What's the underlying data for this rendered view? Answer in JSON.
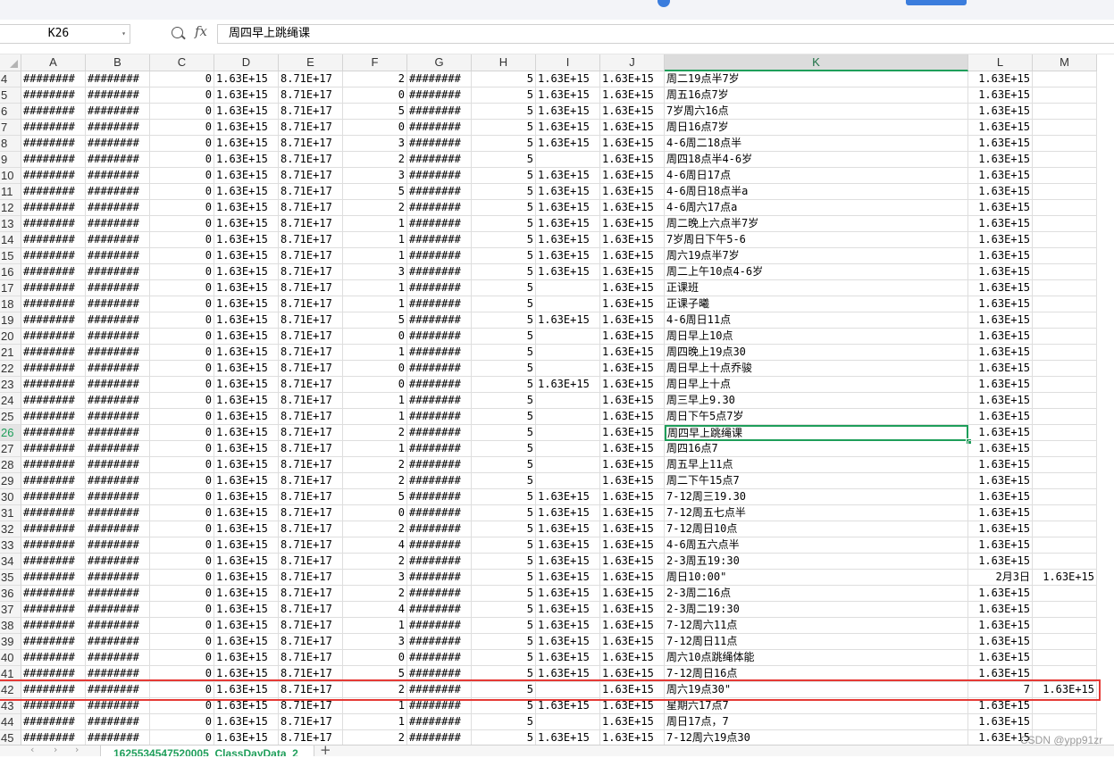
{
  "name_box": "K26",
  "fx_label": "fx",
  "formula_bar": "周四早上跳绳课",
  "active_cell": "K26",
  "columns": [
    "A",
    "B",
    "C",
    "D",
    "E",
    "F",
    "G",
    "H",
    "I",
    "J",
    "K",
    "L",
    "M"
  ],
  "selected_column": "K",
  "rows": [
    {
      "n": "4",
      "A": "########",
      "B": "########",
      "C": "0",
      "D": "1.63E+15",
      "E": "8.71E+17",
      "F": "2",
      "G": "########",
      "H": "5",
      "I": "1.63E+15",
      "J": "1.63E+15",
      "K": "周二19点半7岁",
      "L": "1.63E+15",
      "M": ""
    },
    {
      "n": "5",
      "A": "########",
      "B": "########",
      "C": "0",
      "D": "1.63E+15",
      "E": "8.71E+17",
      "F": "0",
      "G": "########",
      "H": "5",
      "I": "1.63E+15",
      "J": "1.63E+15",
      "K": "周五16点7岁",
      "L": "1.63E+15",
      "M": ""
    },
    {
      "n": "6",
      "A": "########",
      "B": "########",
      "C": "0",
      "D": "1.63E+15",
      "E": "8.71E+17",
      "F": "5",
      "G": "########",
      "H": "5",
      "I": "1.63E+15",
      "J": "1.63E+15",
      "K": "7岁周六16点",
      "L": "1.63E+15",
      "M": ""
    },
    {
      "n": "7",
      "A": "########",
      "B": "########",
      "C": "0",
      "D": "1.63E+15",
      "E": "8.71E+17",
      "F": "0",
      "G": "########",
      "H": "5",
      "I": "1.63E+15",
      "J": "1.63E+15",
      "K": "周日16点7岁",
      "L": "1.63E+15",
      "M": ""
    },
    {
      "n": "8",
      "A": "########",
      "B": "########",
      "C": "0",
      "D": "1.63E+15",
      "E": "8.71E+17",
      "F": "3",
      "G": "########",
      "H": "5",
      "I": "1.63E+15",
      "J": "1.63E+15",
      "K": "4-6周二18点半",
      "L": "1.63E+15",
      "M": ""
    },
    {
      "n": "9",
      "A": "########",
      "B": "########",
      "C": "0",
      "D": "1.63E+15",
      "E": "8.71E+17",
      "F": "2",
      "G": "########",
      "H": "5",
      "I": "",
      "J": "1.63E+15",
      "K": "周四18点半4-6岁",
      "L": "1.63E+15",
      "M": ""
    },
    {
      "n": "10",
      "A": "########",
      "B": "########",
      "C": "0",
      "D": "1.63E+15",
      "E": "8.71E+17",
      "F": "3",
      "G": "########",
      "H": "5",
      "I": "1.63E+15",
      "J": "1.63E+15",
      "K": "4-6周日17点",
      "L": "1.63E+15",
      "M": ""
    },
    {
      "n": "11",
      "A": "########",
      "B": "########",
      "C": "0",
      "D": "1.63E+15",
      "E": "8.71E+17",
      "F": "5",
      "G": "########",
      "H": "5",
      "I": "1.63E+15",
      "J": "1.63E+15",
      "K": "4-6周日18点半a",
      "L": "1.63E+15",
      "M": ""
    },
    {
      "n": "12",
      "A": "########",
      "B": "########",
      "C": "0",
      "D": "1.63E+15",
      "E": "8.71E+17",
      "F": "2",
      "G": "########",
      "H": "5",
      "I": "1.63E+15",
      "J": "1.63E+15",
      "K": "4-6周六17点a",
      "L": "1.63E+15",
      "M": ""
    },
    {
      "n": "13",
      "A": "########",
      "B": "########",
      "C": "0",
      "D": "1.63E+15",
      "E": "8.71E+17",
      "F": "1",
      "G": "########",
      "H": "5",
      "I": "1.63E+15",
      "J": "1.63E+15",
      "K": "周二晚上六点半7岁",
      "L": "1.63E+15",
      "M": ""
    },
    {
      "n": "14",
      "A": "########",
      "B": "########",
      "C": "0",
      "D": "1.63E+15",
      "E": "8.71E+17",
      "F": "1",
      "G": "########",
      "H": "5",
      "I": "1.63E+15",
      "J": "1.63E+15",
      "K": "7岁周日下午5-6",
      "L": "1.63E+15",
      "M": ""
    },
    {
      "n": "15",
      "A": "########",
      "B": "########",
      "C": "0",
      "D": "1.63E+15",
      "E": "8.71E+17",
      "F": "1",
      "G": "########",
      "H": "5",
      "I": "1.63E+15",
      "J": "1.63E+15",
      "K": "周六19点半7岁",
      "L": "1.63E+15",
      "M": ""
    },
    {
      "n": "16",
      "A": "########",
      "B": "########",
      "C": "0",
      "D": "1.63E+15",
      "E": "8.71E+17",
      "F": "3",
      "G": "########",
      "H": "5",
      "I": "1.63E+15",
      "J": "1.63E+15",
      "K": "周二上午10点4-6岁",
      "L": "1.63E+15",
      "M": ""
    },
    {
      "n": "17",
      "A": "########",
      "B": "########",
      "C": "0",
      "D": "1.63E+15",
      "E": "8.71E+17",
      "F": "1",
      "G": "########",
      "H": "5",
      "I": "",
      "J": "1.63E+15",
      "K": "正课班",
      "L": "1.63E+15",
      "M": ""
    },
    {
      "n": "18",
      "A": "########",
      "B": "########",
      "C": "0",
      "D": "1.63E+15",
      "E": "8.71E+17",
      "F": "1",
      "G": "########",
      "H": "5",
      "I": "",
      "J": "1.63E+15",
      "K": "正课子曦",
      "L": "1.63E+15",
      "M": ""
    },
    {
      "n": "19",
      "A": "########",
      "B": "########",
      "C": "0",
      "D": "1.63E+15",
      "E": "8.71E+17",
      "F": "5",
      "G": "########",
      "H": "5",
      "I": "1.63E+15",
      "J": "1.63E+15",
      "K": "4-6周日11点",
      "L": "1.63E+15",
      "M": ""
    },
    {
      "n": "20",
      "A": "########",
      "B": "########",
      "C": "0",
      "D": "1.63E+15",
      "E": "8.71E+17",
      "F": "0",
      "G": "########",
      "H": "5",
      "I": "",
      "J": "1.63E+15",
      "K": "周日早上10点",
      "L": "1.63E+15",
      "M": ""
    },
    {
      "n": "21",
      "A": "########",
      "B": "########",
      "C": "0",
      "D": "1.63E+15",
      "E": "8.71E+17",
      "F": "1",
      "G": "########",
      "H": "5",
      "I": "",
      "J": "1.63E+15",
      "K": "周四晚上19点30",
      "L": "1.63E+15",
      "M": ""
    },
    {
      "n": "22",
      "A": "########",
      "B": "########",
      "C": "0",
      "D": "1.63E+15",
      "E": "8.71E+17",
      "F": "0",
      "G": "########",
      "H": "5",
      "I": "",
      "J": "1.63E+15",
      "K": "周日早上十点乔骏",
      "L": "1.63E+15",
      "M": ""
    },
    {
      "n": "23",
      "A": "########",
      "B": "########",
      "C": "0",
      "D": "1.63E+15",
      "E": "8.71E+17",
      "F": "0",
      "G": "########",
      "H": "5",
      "I": "1.63E+15",
      "J": "1.63E+15",
      "K": "周日早上十点",
      "L": "1.63E+15",
      "M": ""
    },
    {
      "n": "24",
      "A": "########",
      "B": "########",
      "C": "0",
      "D": "1.63E+15",
      "E": "8.71E+17",
      "F": "1",
      "G": "########",
      "H": "5",
      "I": "",
      "J": "1.63E+15",
      "K": "周三早上9.30",
      "L": "1.63E+15",
      "M": ""
    },
    {
      "n": "25",
      "A": "########",
      "B": "########",
      "C": "0",
      "D": "1.63E+15",
      "E": "8.71E+17",
      "F": "1",
      "G": "########",
      "H": "5",
      "I": "",
      "J": "1.63E+15",
      "K": "周日下午5点7岁",
      "L": "1.63E+15",
      "M": ""
    },
    {
      "n": "26",
      "A": "########",
      "B": "########",
      "C": "0",
      "D": "1.63E+15",
      "E": "8.71E+17",
      "F": "2",
      "G": "########",
      "H": "5",
      "I": "",
      "J": "1.63E+15",
      "K": "周四早上跳绳课",
      "L": "1.63E+15",
      "M": ""
    },
    {
      "n": "27",
      "A": "########",
      "B": "########",
      "C": "0",
      "D": "1.63E+15",
      "E": "8.71E+17",
      "F": "1",
      "G": "########",
      "H": "5",
      "I": "",
      "J": "1.63E+15",
      "K": "周四16点7",
      "L": "1.63E+15",
      "M": ""
    },
    {
      "n": "28",
      "A": "########",
      "B": "########",
      "C": "0",
      "D": "1.63E+15",
      "E": "8.71E+17",
      "F": "2",
      "G": "########",
      "H": "5",
      "I": "",
      "J": "1.63E+15",
      "K": "周五早上11点",
      "L": "1.63E+15",
      "M": ""
    },
    {
      "n": "29",
      "A": "########",
      "B": "########",
      "C": "0",
      "D": "1.63E+15",
      "E": "8.71E+17",
      "F": "2",
      "G": "########",
      "H": "5",
      "I": "",
      "J": "1.63E+15",
      "K": "周二下午15点7",
      "L": "1.63E+15",
      "M": ""
    },
    {
      "n": "30",
      "A": "########",
      "B": "########",
      "C": "0",
      "D": "1.63E+15",
      "E": "8.71E+17",
      "F": "5",
      "G": "########",
      "H": "5",
      "I": "1.63E+15",
      "J": "1.63E+15",
      "K": "7-12周三19.30",
      "L": "1.63E+15",
      "M": ""
    },
    {
      "n": "31",
      "A": "########",
      "B": "########",
      "C": "0",
      "D": "1.63E+15",
      "E": "8.71E+17",
      "F": "0",
      "G": "########",
      "H": "5",
      "I": "1.63E+15",
      "J": "1.63E+15",
      "K": "7-12周五七点半",
      "L": "1.63E+15",
      "M": ""
    },
    {
      "n": "32",
      "A": "########",
      "B": "########",
      "C": "0",
      "D": "1.63E+15",
      "E": "8.71E+17",
      "F": "2",
      "G": "########",
      "H": "5",
      "I": "1.63E+15",
      "J": "1.63E+15",
      "K": "7-12周日10点",
      "L": "1.63E+15",
      "M": ""
    },
    {
      "n": "33",
      "A": "########",
      "B": "########",
      "C": "0",
      "D": "1.63E+15",
      "E": "8.71E+17",
      "F": "4",
      "G": "########",
      "H": "5",
      "I": "1.63E+15",
      "J": "1.63E+15",
      "K": "4-6周五六点半",
      "L": "1.63E+15",
      "M": ""
    },
    {
      "n": "34",
      "A": "########",
      "B": "########",
      "C": "0",
      "D": "1.63E+15",
      "E": "8.71E+17",
      "F": "2",
      "G": "########",
      "H": "5",
      "I": "1.63E+15",
      "J": "1.63E+15",
      "K": "2-3周五19:30",
      "L": "1.63E+15",
      "M": ""
    },
    {
      "n": "35",
      "A": "########",
      "B": "########",
      "C": "0",
      "D": "1.63E+15",
      "E": "8.71E+17",
      "F": "3",
      "G": "########",
      "H": "5",
      "I": "1.63E+15",
      "J": "1.63E+15",
      "K": "周日10:00\"",
      "L": "2月3日",
      "M": "1.63E+15"
    },
    {
      "n": "36",
      "A": "########",
      "B": "########",
      "C": "0",
      "D": "1.63E+15",
      "E": "8.71E+17",
      "F": "2",
      "G": "########",
      "H": "5",
      "I": "1.63E+15",
      "J": "1.63E+15",
      "K": "2-3周二16点",
      "L": "1.63E+15",
      "M": ""
    },
    {
      "n": "37",
      "A": "########",
      "B": "########",
      "C": "0",
      "D": "1.63E+15",
      "E": "8.71E+17",
      "F": "4",
      "G": "########",
      "H": "5",
      "I": "1.63E+15",
      "J": "1.63E+15",
      "K": "2-3周二19:30",
      "L": "1.63E+15",
      "M": ""
    },
    {
      "n": "38",
      "A": "########",
      "B": "########",
      "C": "0",
      "D": "1.63E+15",
      "E": "8.71E+17",
      "F": "1",
      "G": "########",
      "H": "5",
      "I": "1.63E+15",
      "J": "1.63E+15",
      "K": "7-12周六11点",
      "L": "1.63E+15",
      "M": ""
    },
    {
      "n": "39",
      "A": "########",
      "B": "########",
      "C": "0",
      "D": "1.63E+15",
      "E": "8.71E+17",
      "F": "3",
      "G": "########",
      "H": "5",
      "I": "1.63E+15",
      "J": "1.63E+15",
      "K": "7-12周日11点",
      "L": "1.63E+15",
      "M": ""
    },
    {
      "n": "40",
      "A": "########",
      "B": "########",
      "C": "0",
      "D": "1.63E+15",
      "E": "8.71E+17",
      "F": "0",
      "G": "########",
      "H": "5",
      "I": "1.63E+15",
      "J": "1.63E+15",
      "K": "周六10点跳绳体能",
      "L": "1.63E+15",
      "M": ""
    },
    {
      "n": "41",
      "A": "########",
      "B": "########",
      "C": "0",
      "D": "1.63E+15",
      "E": "8.71E+17",
      "F": "5",
      "G": "########",
      "H": "5",
      "I": "1.63E+15",
      "J": "1.63E+15",
      "K": "7-12周日16点",
      "L": "1.63E+15",
      "M": ""
    },
    {
      "n": "42",
      "A": "########",
      "B": "########",
      "C": "0",
      "D": "1.63E+15",
      "E": "8.71E+17",
      "F": "2",
      "G": "########",
      "H": "5",
      "I": "",
      "J": "1.63E+15",
      "K": "周六19点30\"",
      "L": "7",
      "M": "1.63E+15"
    },
    {
      "n": "43",
      "A": "########",
      "B": "########",
      "C": "0",
      "D": "1.63E+15",
      "E": "8.71E+17",
      "F": "1",
      "G": "########",
      "H": "5",
      "I": "1.63E+15",
      "J": "1.63E+15",
      "K": "星期六17点7",
      "L": "1.63E+15",
      "M": ""
    },
    {
      "n": "44",
      "A": "########",
      "B": "########",
      "C": "0",
      "D": "1.63E+15",
      "E": "8.71E+17",
      "F": "1",
      "G": "########",
      "H": "5",
      "I": "",
      "J": "1.63E+15",
      "K": "周日17点，7",
      "L": "1.63E+15",
      "M": ""
    },
    {
      "n": "45",
      "A": "########",
      "B": "########",
      "C": "0",
      "D": "1.63E+15",
      "E": "8.71E+17",
      "F": "2",
      "G": "########",
      "H": "5",
      "I": "1.63E+15",
      "J": "1.63E+15",
      "K": "7-12周六19点30",
      "L": "1.63E+15",
      "M": ""
    }
  ],
  "sheet_tab": "1625534547520005_ClassDayData_2",
  "add_sheet": "+",
  "watermark": "CSDN @ypp91zr",
  "colors": {
    "accent_green": "#1e9e5a",
    "highlight_red": "#e53935"
  }
}
